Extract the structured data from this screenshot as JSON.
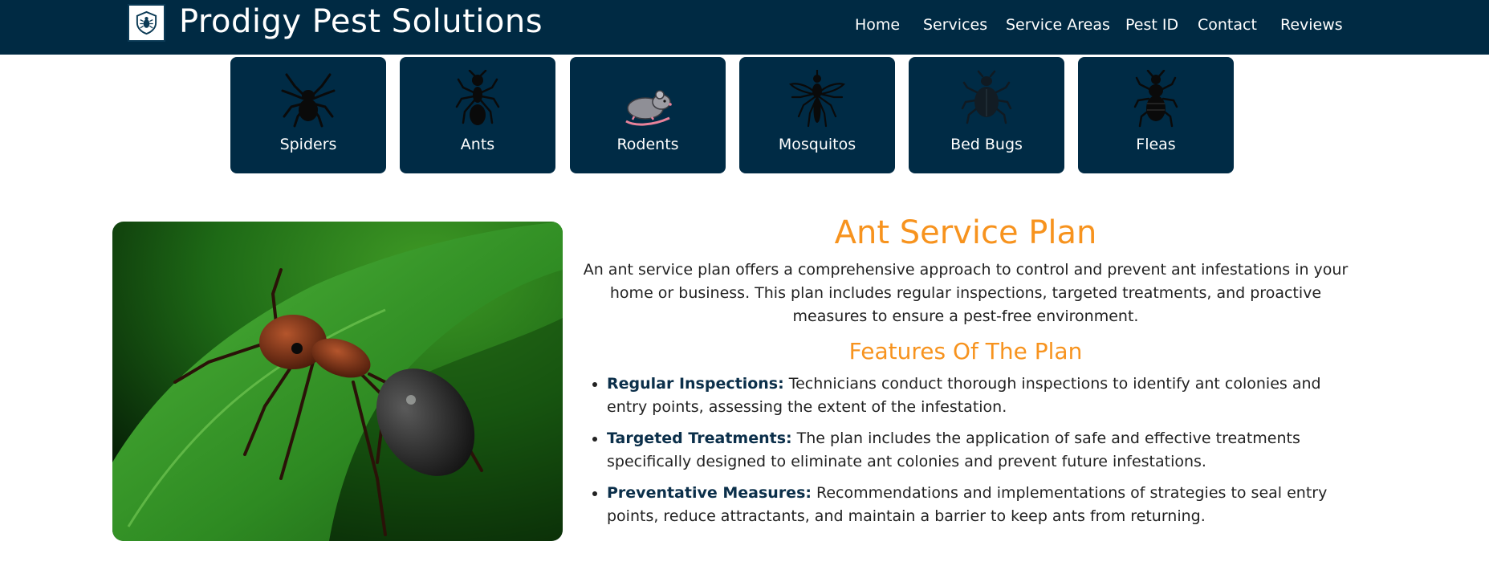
{
  "header": {
    "brand": "Prodigy Pest Solutions",
    "logo_icon": "bug-shield-icon",
    "nav": [
      "Home",
      "Services",
      "Service Areas",
      "Pest ID",
      "Contact",
      "Reviews"
    ]
  },
  "pests": [
    {
      "label": "Spiders",
      "icon": "spider-icon"
    },
    {
      "label": "Ants",
      "icon": "ant-icon"
    },
    {
      "label": "Rodents",
      "icon": "rodent-icon"
    },
    {
      "label": "Mosquitos",
      "icon": "mosquito-icon"
    },
    {
      "label": "Bed Bugs",
      "icon": "bed-bug-icon"
    },
    {
      "label": "Fleas",
      "icon": "flea-icon"
    }
  ],
  "main": {
    "title": "Ant Service Plan",
    "intro": "An ant service plan offers a comprehensive approach to control and prevent ant infestations in your home or business. This plan includes regular inspections, targeted treatments, and proactive measures to ensure a pest-free environment.",
    "features_title": "Features Of The Plan",
    "features": [
      {
        "title": "Regular Inspections:",
        "text": " Technicians conduct thorough inspections to identify ant colonies and entry points, assessing the extent of the infestation."
      },
      {
        "title": "Targeted Treatments:",
        "text": " The plan includes the application of safe and effective treatments specifically designed to eliminate ant colonies and prevent future infestations."
      },
      {
        "title": "Preventative Measures:",
        "text": " Recommendations and implementations of strategies to seal entry points, reduce attractants, and maintain a barrier to keep ants from returning."
      }
    ]
  },
  "colors": {
    "navy": "#002a43",
    "orange": "#f7931e",
    "card": "#002b45"
  }
}
